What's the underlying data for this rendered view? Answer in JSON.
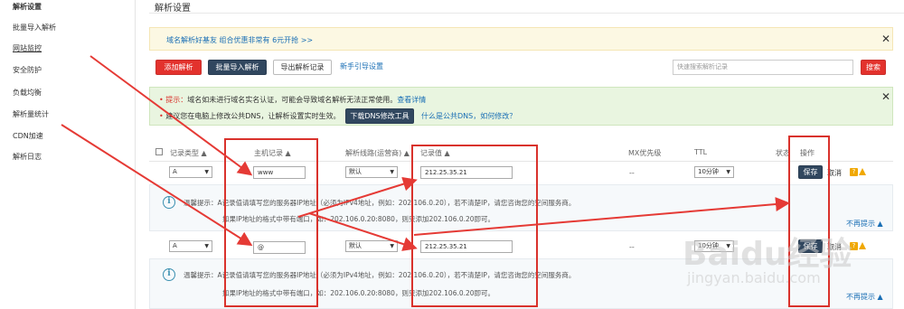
{
  "sidebar": {
    "items": [
      {
        "label": "解析设置"
      },
      {
        "label": "批量导入解析"
      },
      {
        "label": "网站监控"
      },
      {
        "label": "安全防护"
      },
      {
        "label": "负载均衡"
      },
      {
        "label": "解析量统计"
      },
      {
        "label": "CDN加速"
      },
      {
        "label": "解析日志"
      }
    ]
  },
  "page": {
    "title": "解析设置"
  },
  "promo": {
    "text": "域名解析好基友 组合优惠非常有 6元开抢 >>"
  },
  "toolbar": {
    "add": "添加解析",
    "batch": "批量导入解析",
    "export": "导出解析记录",
    "guide": "新手引导设置",
    "search_placeholder": "快速搜索解析记录",
    "search_btn": "搜索"
  },
  "notice": {
    "prefix": "提示：",
    "line1": "域名如未进行域名实名认证，可能会导致域名解析无法正常使用。",
    "line1_link": "查看详情",
    "line2": "建议您在电脑上修改公共DNS，让解析设置实时生效。",
    "dns_btn": "下载DNS修改工具",
    "dns_link": "什么是公共DNS，如何修改？"
  },
  "table": {
    "headers": {
      "type": "记录类型",
      "host": "主机记录",
      "line": "解析线路(运营商)",
      "value": "记录值",
      "mx": "MX优先级",
      "ttl": "TTL",
      "status": "状态",
      "action": "操作"
    },
    "rows": [
      {
        "type": "A",
        "host": "www",
        "line": "默认",
        "value": "212.25.35.21",
        "mx": "--",
        "ttl": "10分钟",
        "save": "保存",
        "cancel": "取消"
      },
      {
        "type": "A",
        "host": "@",
        "line": "默认",
        "value": "212.25.35.21",
        "mx": "--",
        "ttl": "10分钟",
        "save": "保存",
        "cancel": "取消"
      }
    ]
  },
  "tip": {
    "line1": "温馨提示：A记录值请填写您的服务器IP地址（必须为IPv4地址，例如：202.106.0.20），若不清楚IP，请您咨询您的空间服务商。",
    "line2": "如果IP地址的格式中带有端口，如：202.106.0.20:8080，则只添加202.106.0.20即可。",
    "hide": "不再提示"
  },
  "watermark": {
    "brand": "Baidu经验",
    "url": "jingyan.baidu.com"
  },
  "colors": {
    "red": "#d9322c",
    "dark": "#31475f",
    "link": "#1a6fb5"
  }
}
